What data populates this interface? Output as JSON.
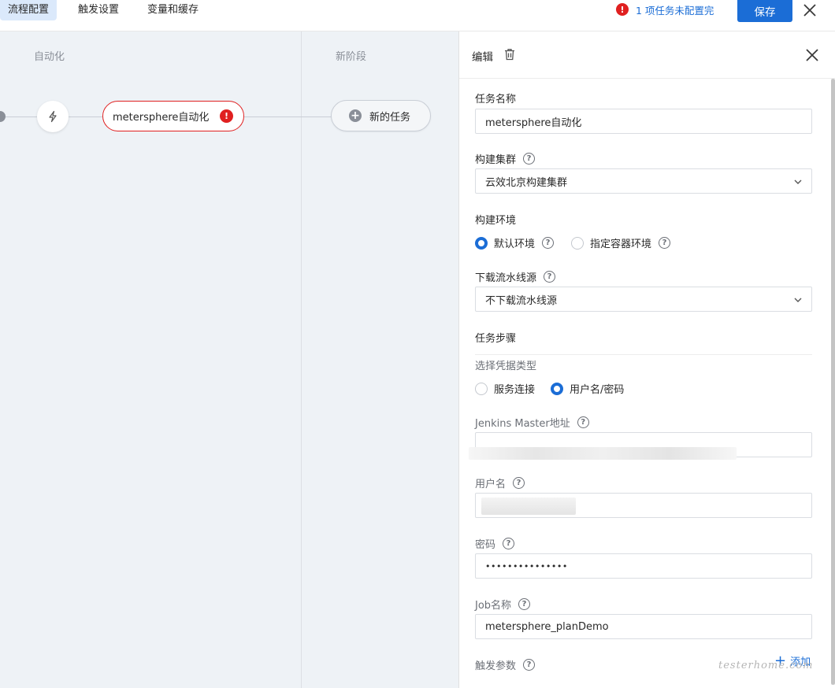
{
  "topbar": {
    "tabs": [
      "流程配置",
      "触发设置",
      "变量和缓存"
    ],
    "warning_count": "!",
    "warning_text": "1 项任务未配置完",
    "save_label": "保存"
  },
  "canvas": {
    "stage1_title": "自动化",
    "stage2_title": "新阶段",
    "task_name": "metersphere自动化",
    "task_error": "!",
    "new_task_label": "新的任务"
  },
  "panel": {
    "title": "编辑",
    "task_name_label": "任务名称",
    "task_name_value": "metersphere自动化",
    "cluster_label": "构建集群",
    "cluster_value": "云效北京构建集群",
    "env_label": "构建环境",
    "env_options": [
      "默认环境",
      "指定容器环境"
    ],
    "download_label": "下载流水线源",
    "download_value": "不下载流水线源",
    "steps_label": "任务步骤",
    "cred_type_label": "选择凭据类型",
    "cred_options": [
      "服务连接",
      "用户名/密码"
    ],
    "jenkins_label": "Jenkins Master地址",
    "username_label": "用户名",
    "password_label": "密码",
    "password_value": "•••••••••••••••",
    "job_label": "Job名称",
    "job_value": "metersphere_planDemo",
    "params_label": "触发参数",
    "add_label": "添加",
    "help_glyph": "?"
  },
  "watermark": "testerhome.com",
  "colors": {
    "accent": "#1b6dd6",
    "error": "#e02020",
    "canvas_bg": "#eef2f6"
  }
}
